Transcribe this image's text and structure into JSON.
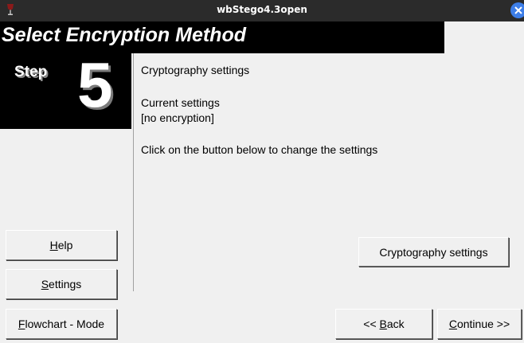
{
  "window": {
    "title": "wbStego4.3open",
    "app_icon": "wine-glass-icon",
    "close_icon": "close-icon",
    "accent_color": "#3d7ee8"
  },
  "header": {
    "title": "Select Encryption Method"
  },
  "step": {
    "label": "Step",
    "number": "5"
  },
  "content": {
    "heading": "Cryptography settings",
    "current_label": "Current settings",
    "current_value": "[no encryption]",
    "instruction": "Click on the button below to change the settings"
  },
  "buttons": {
    "help": {
      "mnemonic": "H",
      "rest": "elp"
    },
    "settings": {
      "mnemonic": "S",
      "rest": "ettings"
    },
    "flowchart": {
      "mnemonic": "F",
      "rest": "lowchart - Mode"
    },
    "crypto": {
      "label": "Cryptography settings"
    },
    "back": {
      "prefix": "<< ",
      "mnemonic": "B",
      "rest": "ack"
    },
    "continue": {
      "mnemonic": "C",
      "rest": "ontinue >>"
    }
  }
}
